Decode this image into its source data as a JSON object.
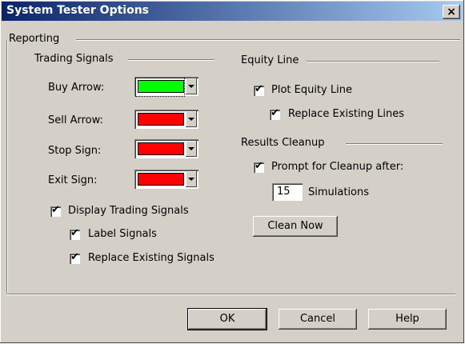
{
  "window": {
    "title": "System Tester Options",
    "close_glyph": "×"
  },
  "reporting": {
    "label": "Reporting",
    "trading_signals": {
      "label": "Trading Signals",
      "items": [
        {
          "label": "Buy Arrow:",
          "color": "#00ff00"
        },
        {
          "label": "Sell Arrow:",
          "color": "#ff0000"
        },
        {
          "label": "Stop Sign:",
          "color": "#ff0000"
        },
        {
          "label": "Exit Sign:",
          "color": "#ff0000"
        }
      ],
      "display_signals": "Display Trading Signals",
      "label_signals": "Label Signals",
      "replace_signals": "Replace Existing Signals"
    },
    "equity_line": {
      "label": "Equity Line",
      "plot": "Plot Equity Line",
      "replace": "Replace Existing Lines"
    },
    "results_cleanup": {
      "label": "Results Cleanup",
      "prompt": "Prompt for Cleanup after:",
      "simulations_value": "15",
      "simulations_label": "Simulations",
      "clean_now": "Clean Now"
    }
  },
  "buttons": {
    "ok": "OK",
    "cancel": "Cancel",
    "help": "Help"
  }
}
